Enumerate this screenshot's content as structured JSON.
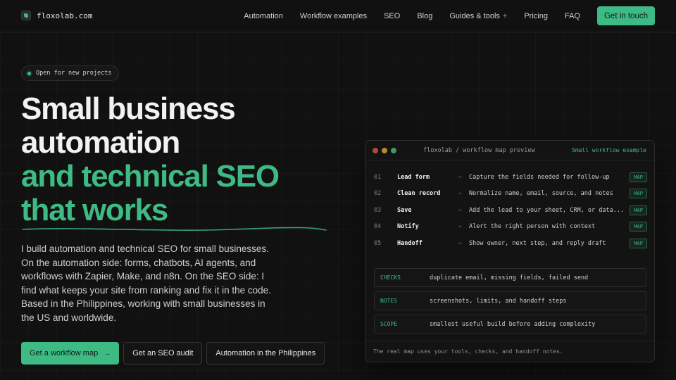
{
  "nav": {
    "brand": "floxolab.com",
    "links": [
      "Automation",
      "Workflow examples",
      "SEO",
      "Blog",
      "Guides & tools",
      "Pricing",
      "FAQ"
    ],
    "guides_plus": "+",
    "cta": "Get in touch"
  },
  "hero": {
    "badge": "Open for new projects",
    "headline": [
      "Small business",
      "automation",
      "and technical SEO",
      "that works"
    ],
    "lead": "I build automation and technical SEO for small businesses. On the automation side: forms, chatbots, AI agents, and workflows with Zapier, Make, and n8n. On the SEO side: I find what keeps your site from ranking and fix it in the code. Based in the Philippines, working with small businesses in the US and worldwide.",
    "buttons": {
      "primary": "Get a workflow map",
      "primary_arrow": "→",
      "seo_audit": "Get an SEO audit",
      "philippines": "Automation in the Philippines"
    }
  },
  "panel": {
    "title": "floxolab / workflow map preview",
    "tag": "Small workflow example",
    "arrow": "→",
    "badge": "MAP",
    "steps": [
      {
        "num": "01",
        "name": "Lead form",
        "desc": "Capture the fields needed for follow-up"
      },
      {
        "num": "02",
        "name": "Clean record",
        "desc": "Normalize name, email, source, and notes"
      },
      {
        "num": "03",
        "name": "Save",
        "desc": "Add the lead to your sheet, CRM, or data..."
      },
      {
        "num": "04",
        "name": "Notify",
        "desc": "Alert the right person with context"
      },
      {
        "num": "05",
        "name": "Handoff",
        "desc": "Show owner, next step, and reply draft"
      }
    ],
    "checks": [
      {
        "label": "CHECKS",
        "text": "duplicate email, missing fields, failed send"
      },
      {
        "label": "NOTES",
        "text": "screenshots, limits, and handoff steps"
      },
      {
        "label": "SCOPE",
        "text": "smallest useful build before adding complexity"
      }
    ],
    "footer": "The real map uses your tools, checks, and handoff notes."
  },
  "colors": {
    "accent": "#3ebb84",
    "background": "#111111"
  }
}
